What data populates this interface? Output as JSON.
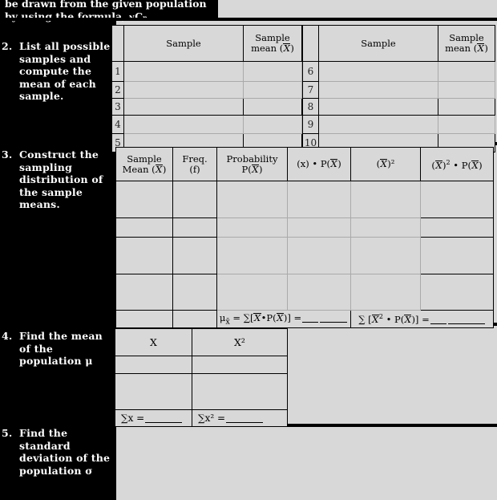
{
  "banner": {
    "line1": "be drawn from the given population",
    "line2_pre": "by using the formula, ",
    "formula_sub1": "N",
    "formula_C": "C",
    "formula_sub2": "n,"
  },
  "instructions": [
    {
      "num": "2.",
      "text": "List all possible samples and compute the mean of each sample."
    },
    {
      "num": "3.",
      "text": "Construct the sampling distribution of the sample means."
    },
    {
      "num": "4.",
      "text": "Find the mean of the population μ"
    },
    {
      "num": "5.",
      "text": "Find the standard deviation of the population σ"
    }
  ],
  "sample_tables": {
    "headers": {
      "sample": "Sample",
      "sample_mean_l1": "Sample",
      "sample_mean_l2_pre": "mean (",
      "sample_mean_var": "X",
      "sample_mean_l2_post": ")"
    },
    "left_rows": [
      "1",
      "2",
      "3",
      "4",
      "5"
    ],
    "right_rows": [
      "6",
      "7",
      "8",
      "9",
      "10"
    ]
  },
  "dist_table": {
    "headers": [
      {
        "l1": "Sample",
        "l2_pre": "Mean (",
        "var": "X",
        "l2_post": ")"
      },
      {
        "l1": "Freq.",
        "l2_pre": "(f)",
        "var": "",
        "l2_post": ""
      },
      {
        "l1": "Probability",
        "l2_pre": "P(",
        "var": "X",
        "l2_post": ")"
      },
      {
        "l1": "",
        "l2_pre": "(x) • P(",
        "var": "X",
        "l2_post": ")"
      },
      {
        "l1": "",
        "l2_pre": "(",
        "var": "X",
        "l2_post": ")²"
      },
      {
        "l1": "",
        "l2_pre": "(",
        "var": "X",
        "l2_post": ")² • P(X)"
      }
    ],
    "header_c4": "(x) • P(X)",
    "header_c5": "(X)²",
    "header_c6": "(X)² • P(X)",
    "footer_mean": "μₓ = ∑[X•P(X)] =",
    "footer_sumsq": "∑ [X² • P(X)] =",
    "body_row_count": 5
  },
  "population_table": {
    "col1_header": "X",
    "col2_header": "X²",
    "footer_sum_x": "∑x =",
    "footer_sum_x2": "∑x² =",
    "body_row_count": 3
  },
  "colors": {
    "page_background": "#d8d8d8",
    "panel_background": "#000000",
    "panel_text": "#ffffff",
    "rule": "#000000"
  }
}
